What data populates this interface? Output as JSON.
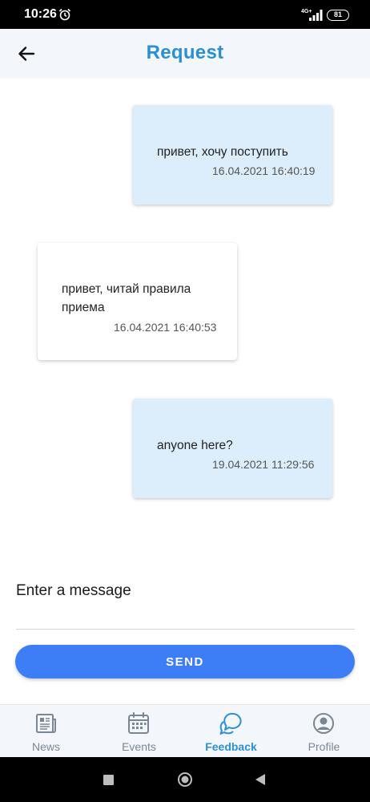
{
  "status_bar": {
    "time": "10:26",
    "network": "4G+",
    "battery": "81"
  },
  "header": {
    "title": "Request"
  },
  "messages": [
    {
      "text_lines": [
        "привет, хочу поступить"
      ],
      "time": "16.04.2021 16:40:19",
      "side": "mine"
    },
    {
      "text_lines": [
        "привет, читай правила",
        "приема"
      ],
      "time": "16.04.2021 16:40:53",
      "side": "theirs"
    },
    {
      "text_lines": [
        "anyone here?"
      ],
      "time": "19.04.2021 11:29:56",
      "side": "mine"
    }
  ],
  "composer": {
    "placeholder": "Enter a message",
    "send_label": "SEND"
  },
  "bottom_nav": {
    "items": [
      {
        "label": "News",
        "icon": "newspaper-icon"
      },
      {
        "label": "Events",
        "icon": "calendar-icon"
      },
      {
        "label": "Feedback",
        "icon": "chat-bubbles-icon"
      },
      {
        "label": "Profile",
        "icon": "account-circle-icon"
      }
    ],
    "active": "Feedback"
  },
  "colors": {
    "accent": "#2b8fd6",
    "send_button": "#3d7ef7",
    "my_bubble": "#dceefc",
    "header_bg": "#f3f7fb"
  }
}
